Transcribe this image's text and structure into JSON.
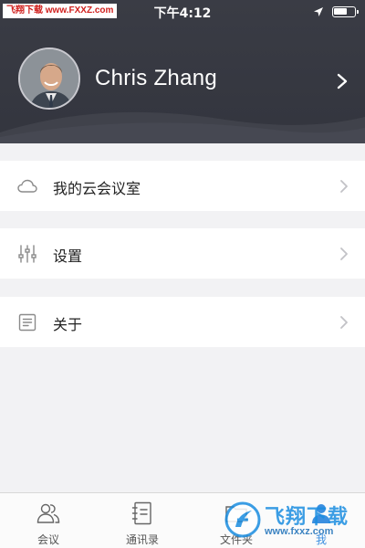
{
  "status_bar": {
    "watermark": "飞翔下载 www.FXXZ.com",
    "time": "下午4:12"
  },
  "profile": {
    "name": "Chris Zhang"
  },
  "menu": [
    {
      "label": "我的云会议室",
      "icon": "cloud-icon"
    },
    {
      "label": "设置",
      "icon": "sliders-icon"
    },
    {
      "label": "关于",
      "icon": "document-icon"
    }
  ],
  "tabbar": [
    {
      "label": "会议",
      "icon": "people-icon",
      "active": false
    },
    {
      "label": "通讯录",
      "icon": "address-book-icon",
      "active": false
    },
    {
      "label": "文件夹",
      "icon": "folder-icon",
      "active": false
    },
    {
      "label": "我",
      "icon": "person-icon",
      "active": true
    }
  ],
  "watermark_br": {
    "title": "飞翔下载",
    "url": "www.fxxz.com"
  },
  "colors": {
    "header_bg": "#35373f",
    "active_tab": "#3b8fe0",
    "page_bg": "#f2f2f4"
  }
}
